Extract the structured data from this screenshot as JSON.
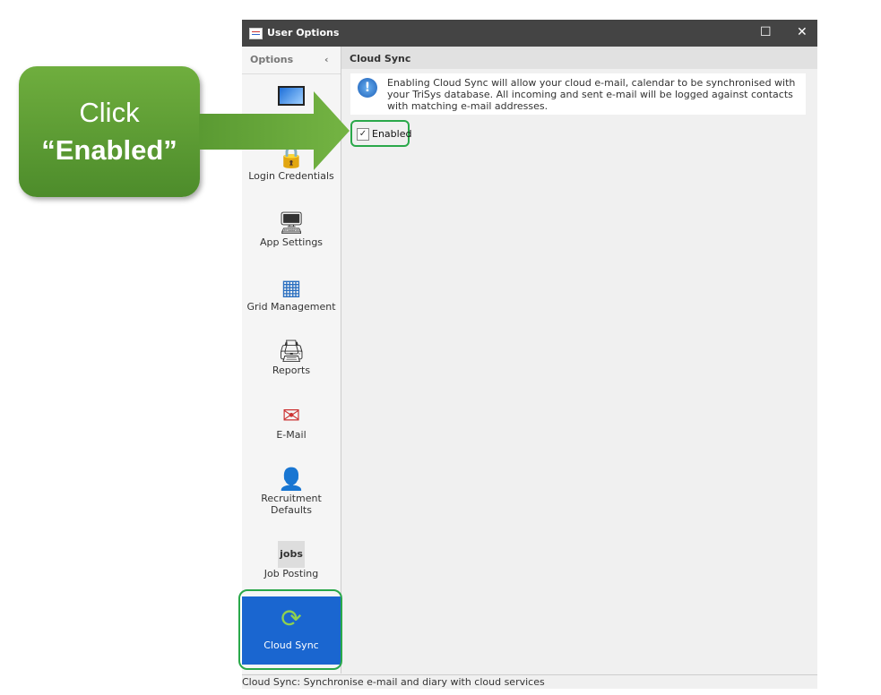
{
  "window": {
    "title": "User Options",
    "maximize": "☐",
    "close": "✕"
  },
  "sidebar": {
    "header": "Options",
    "collapse": "‹",
    "items": [
      {
        "label": "",
        "icon": "monitor-icon"
      },
      {
        "label": "Login Credentials",
        "icon": "lock-icon"
      },
      {
        "label": "App Settings",
        "icon": "computer-icon"
      },
      {
        "label": "Grid Management",
        "icon": "grid-icon"
      },
      {
        "label": "Reports",
        "icon": "printer-icon"
      },
      {
        "label": "E-Mail",
        "icon": "email-icon"
      },
      {
        "label": "Recruitment Defaults",
        "icon": "recruiter-icon"
      },
      {
        "label": "Job Posting",
        "icon": "jobs-icon"
      },
      {
        "label": "Cloud Sync",
        "icon": "sync-icon",
        "selected": true
      }
    ]
  },
  "content": {
    "title": "Cloud Sync",
    "info": "Enabling Cloud Sync will allow your cloud e-mail, calendar to be synchronised with your TriSys database. All incoming and sent e-mail will be logged against contacts with matching e-mail addresses.",
    "checkbox": {
      "label": "Enabled",
      "checked": true,
      "mark": "✓"
    }
  },
  "status": "Cloud Sync: Synchronise e-mail and diary with cloud services",
  "callout": {
    "line1": "Click",
    "line2": "“Enabled”",
    "color": "#5e9e35"
  },
  "colors": {
    "selected": "#1a66d0",
    "highlight": "#2aa84a",
    "titlebar": "#444444"
  }
}
